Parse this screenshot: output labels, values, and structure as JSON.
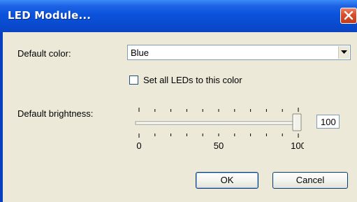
{
  "window": {
    "title": "LED Module..."
  },
  "form": {
    "default_color_label": "Default color:",
    "default_color_value": "Blue",
    "set_all_label": "Set all LEDs to this color",
    "set_all_checked": false,
    "brightness_label": "Default brightness:",
    "brightness_value": "100",
    "brightness_level": 1.0,
    "brightness_ticks": [
      "0",
      "50",
      "100"
    ]
  },
  "buttons": {
    "ok": "OK",
    "cancel": "Cancel"
  },
  "colors": {
    "titlebar": "#0b52db",
    "client_bg": "#ece9d8",
    "close_button": "#d9502e"
  }
}
